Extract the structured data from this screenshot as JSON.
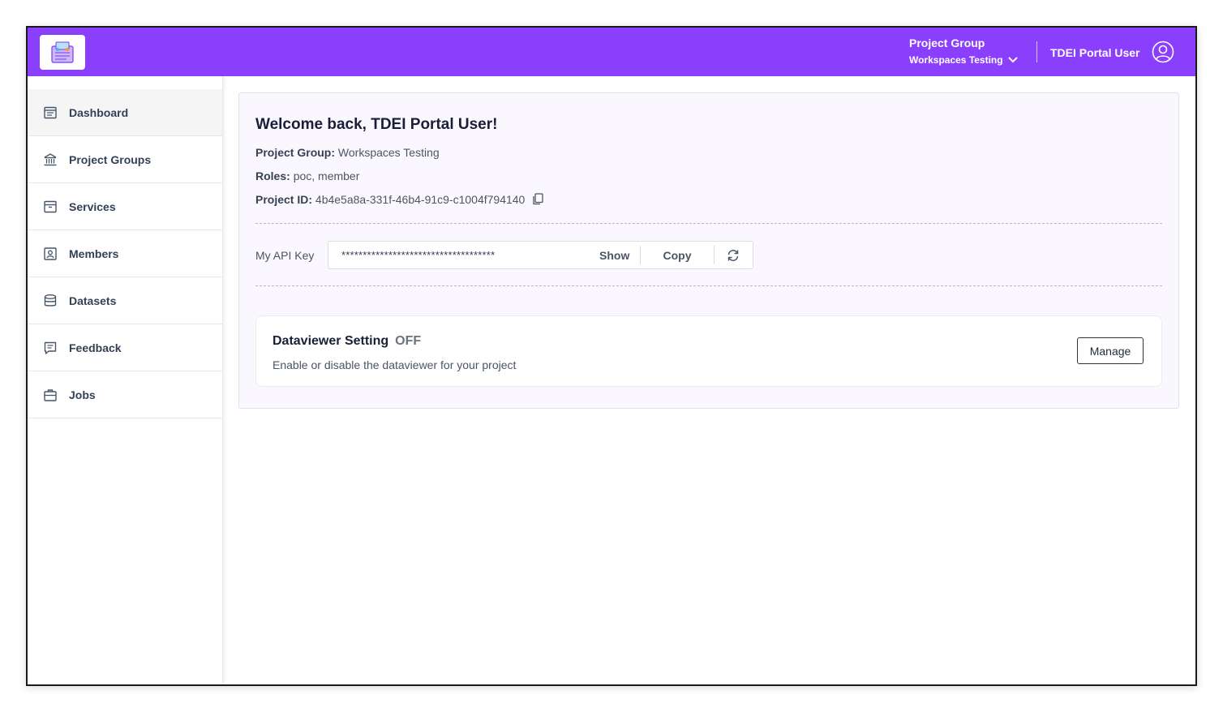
{
  "header": {
    "project_group_label": "Project Group",
    "project_group_value": "Workspaces Testing",
    "user_name": "TDEI Portal User",
    "brand_color": "#8a3ffc"
  },
  "sidebar": {
    "items": [
      {
        "label": "Dashboard",
        "icon": "dashboard-icon",
        "active": true
      },
      {
        "label": "Project Groups",
        "icon": "bank-icon"
      },
      {
        "label": "Services",
        "icon": "archive-icon"
      },
      {
        "label": "Members",
        "icon": "member-icon"
      },
      {
        "label": "Datasets",
        "icon": "database-icon"
      },
      {
        "label": "Feedback",
        "icon": "feedback-icon"
      },
      {
        "label": "Jobs",
        "icon": "briefcase-icon"
      }
    ]
  },
  "main": {
    "welcome": "Welcome back, TDEI Portal User!",
    "project_group_label": "Project Group:",
    "project_group_value": "Workspaces Testing",
    "roles_label": "Roles:",
    "roles_value": "poc, member",
    "project_id_label": "Project ID:",
    "project_id_value": "4b4e5a8a-331f-46b4-91c9-c1004f794140",
    "api_key_label": "My API Key",
    "api_key_masked": "************************************",
    "show_label": "Show",
    "copy_label": "Copy",
    "dataviewer": {
      "title": "Dataviewer Setting",
      "status": "OFF",
      "description": "Enable or disable the dataviewer for your project",
      "manage_label": "Manage"
    }
  }
}
